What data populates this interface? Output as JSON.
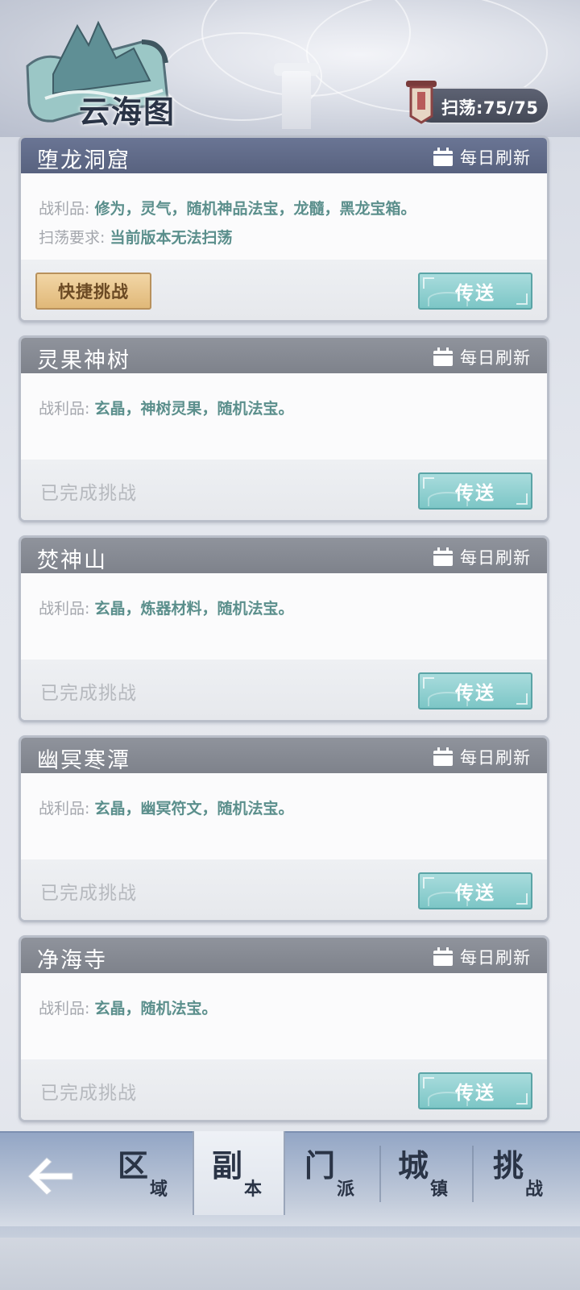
{
  "header": {
    "title": "云海图",
    "sweep_label": "扫荡:75/75"
  },
  "dungeons": [
    {
      "name": "堕龙洞窟",
      "refresh": "每日刷新",
      "loot_key": "战利品:",
      "loot_value": "修为，灵气，随机神品法宝，龙髓，黑龙宝箱。",
      "sweep_key": "扫荡要求:",
      "sweep_value": "当前版本无法扫荡",
      "quick_label": "快捷挑战",
      "teleport_label": "传送"
    },
    {
      "name": "灵果神树",
      "refresh": "每日刷新",
      "loot_key": "战利品:",
      "loot_value": "玄晶，神树灵果，随机法宝。",
      "status": "已完成挑战",
      "teleport_label": "传送"
    },
    {
      "name": "焚神山",
      "refresh": "每日刷新",
      "loot_key": "战利品:",
      "loot_value": "玄晶，炼器材料，随机法宝。",
      "status": "已完成挑战",
      "teleport_label": "传送"
    },
    {
      "name": "幽冥寒潭",
      "refresh": "每日刷新",
      "loot_key": "战利品:",
      "loot_value": "玄晶，幽冥符文，随机法宝。",
      "status": "已完成挑战",
      "teleport_label": "传送"
    },
    {
      "name": "净海寺",
      "refresh": "每日刷新",
      "loot_key": "战利品:",
      "loot_value": "玄晶，随机法宝。",
      "status": "已完成挑战",
      "teleport_label": "传送"
    }
  ],
  "nav": {
    "tabs": [
      {
        "big": "区",
        "small": "域"
      },
      {
        "big": "副",
        "small": "本"
      },
      {
        "big": "门",
        "small": "派"
      },
      {
        "big": "城",
        "small": "镇"
      },
      {
        "big": "挑",
        "small": "战"
      }
    ]
  },
  "colors": {
    "active_header": "#5f6a88",
    "inactive_header": "#858991",
    "loot_text": "#5b8f8c",
    "teleport_button": "#8ccfcf",
    "quick_button": "#e8c68c"
  }
}
